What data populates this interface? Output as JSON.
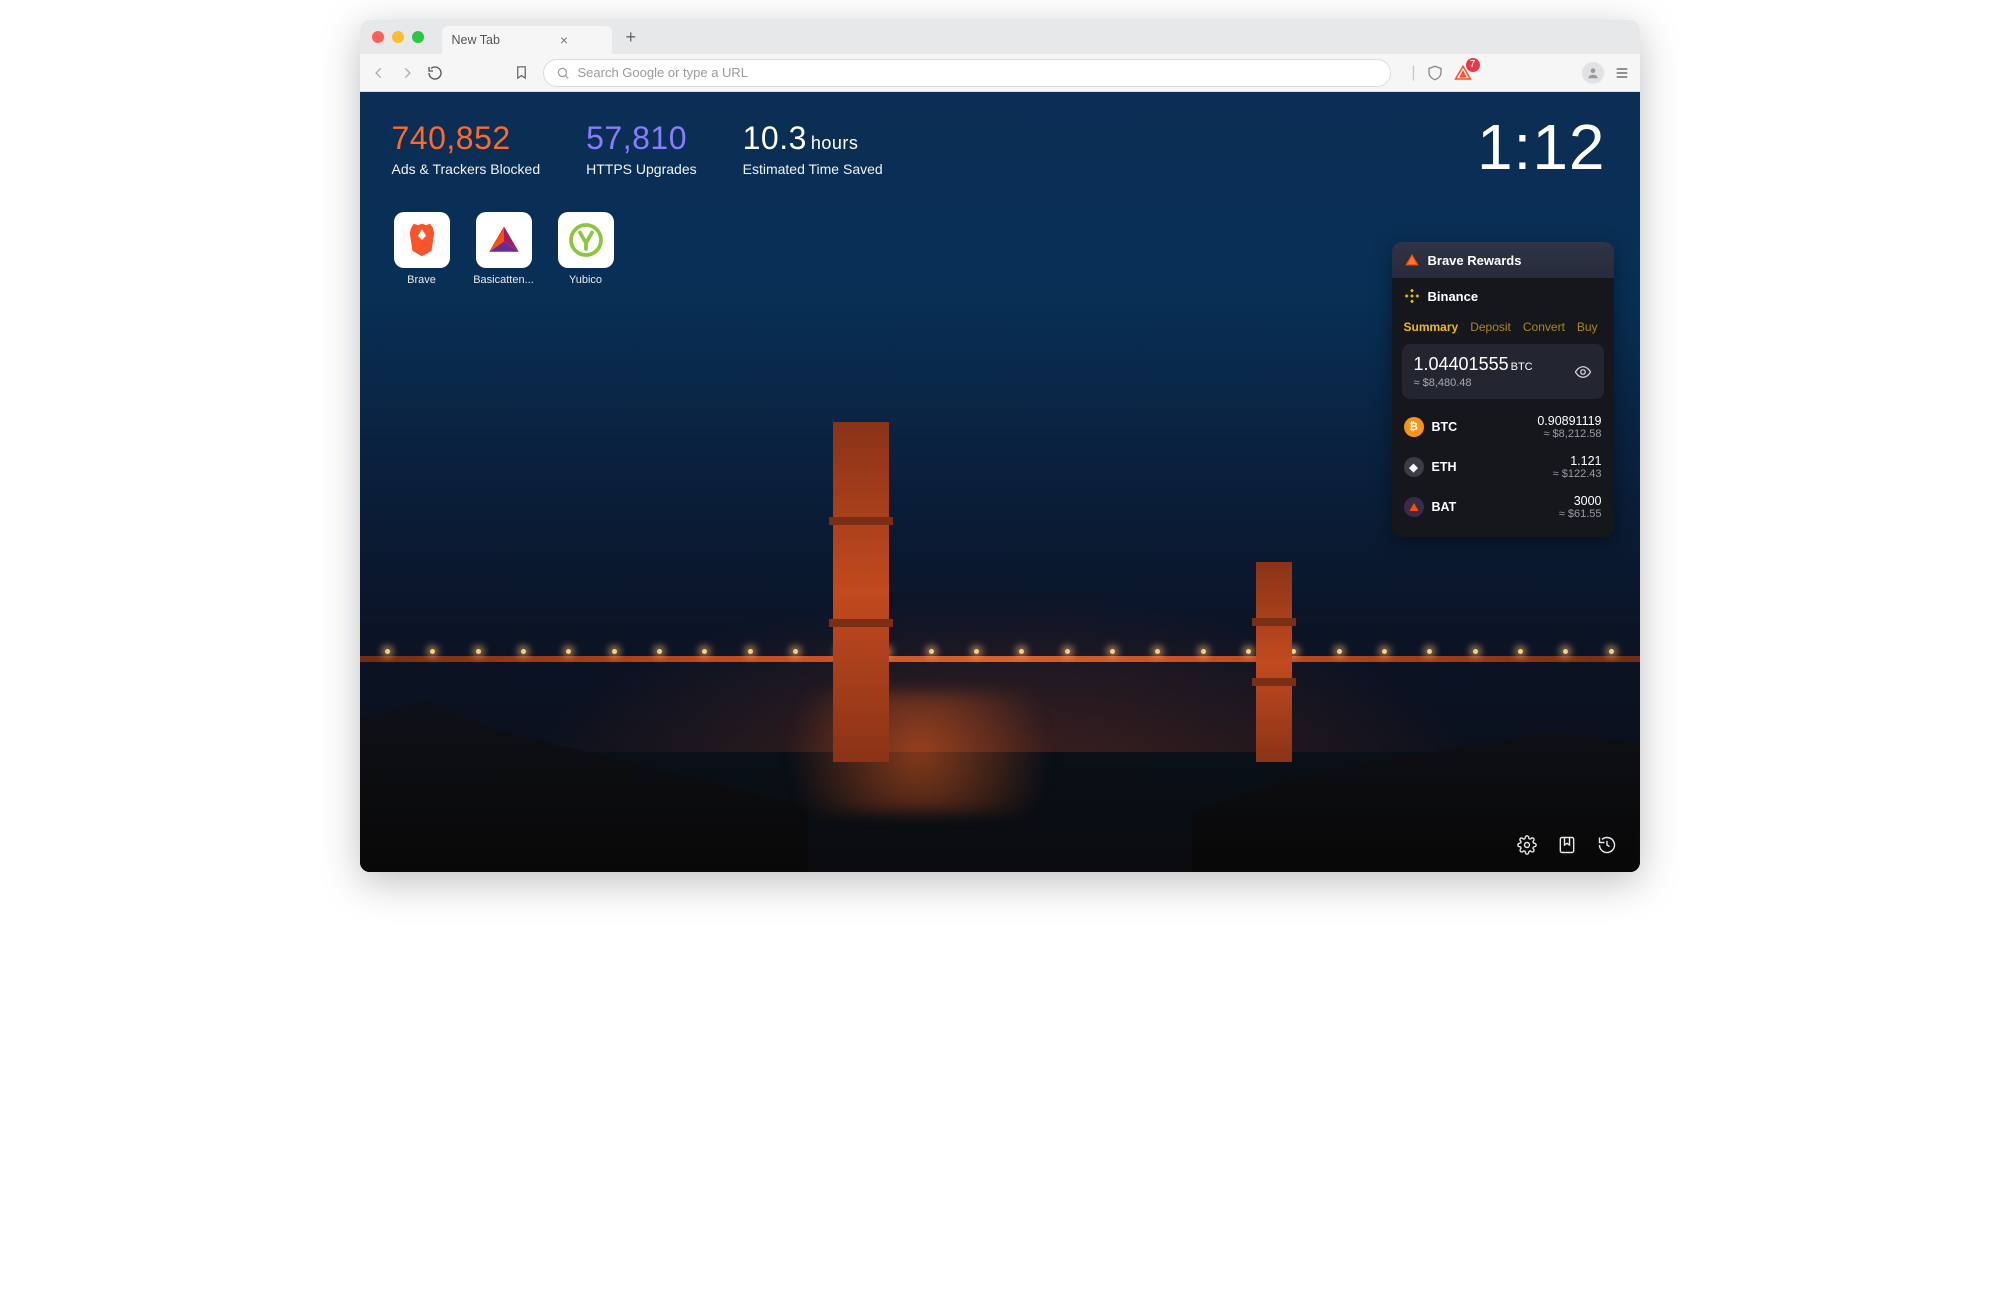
{
  "tab": {
    "title": "New Tab"
  },
  "toolbar": {
    "search_placeholder": "Search Google or type a URL",
    "badge_count": "7"
  },
  "stats": {
    "ads": {
      "value": "740,852",
      "label": "Ads & Trackers Blocked"
    },
    "https": {
      "value": "57,810",
      "label": "HTTPS Upgrades"
    },
    "time": {
      "value": "10.3",
      "unit": "hours",
      "label": "Estimated Time Saved"
    }
  },
  "favorites": [
    {
      "name": "Brave"
    },
    {
      "name": "Basicatten..."
    },
    {
      "name": "Yubico"
    }
  ],
  "clock": "1:12",
  "rewards": {
    "title": "Brave Rewards"
  },
  "binance": {
    "title": "Binance",
    "tabs": [
      "Summary",
      "Deposit",
      "Convert",
      "Buy"
    ],
    "active_tab": "Summary",
    "total": {
      "amount": "1.04401555",
      "unit": "BTC",
      "fiat": "≈ $8,480.48"
    },
    "assets": [
      {
        "sym": "BTC",
        "qty": "0.90891119",
        "fiat": "≈ $8,212.58"
      },
      {
        "sym": "ETH",
        "qty": "1.121",
        "fiat": "≈ $122.43"
      },
      {
        "sym": "BAT",
        "qty": "3000",
        "fiat": "≈ $61.55"
      }
    ]
  }
}
